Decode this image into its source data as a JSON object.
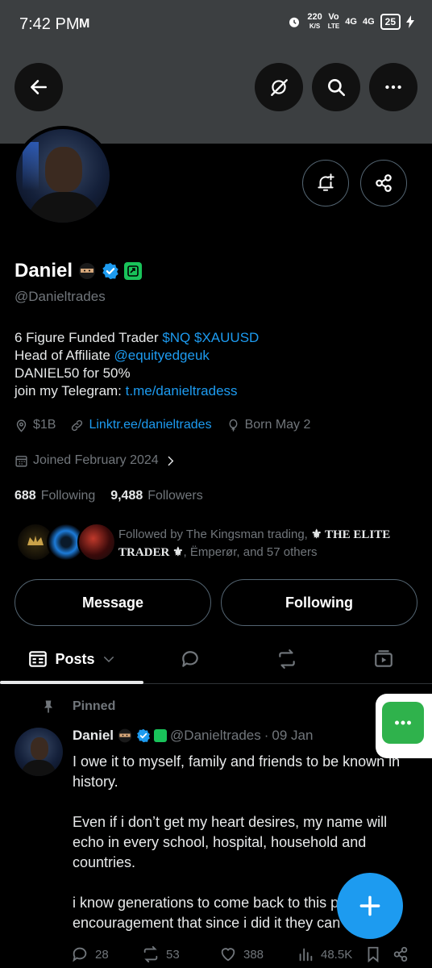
{
  "status_bar": {
    "time": "7:42 PM",
    "mail_glyph": "M",
    "net_speed_value": "220",
    "net_speed_unit": "K/S",
    "volte_top": "Vo",
    "volte_bottom": "LTE",
    "sig1_label": "4G",
    "sig2_label": "4G",
    "battery": "25"
  },
  "profile": {
    "name": "Daniel",
    "handle": "@Danieltrades",
    "bio": {
      "line1_text": "6 Figure Funded Trader ",
      "line1_link": "$NQ $XAUUSD",
      "line2_text": "Head of Affiliate ",
      "line2_link": "@equityedgeuk",
      "line3_text": "DANIEL50 for 50%",
      "line4_text": "join my Telegram: ",
      "line4_link": "t.me/danieltradess"
    },
    "location": "$1B",
    "website": "Linktr.ee/danieltrades",
    "birthday": "Born May 2",
    "joined": "Joined February 2024",
    "following_count": "688",
    "following_label": "Following",
    "followers_count": "9,488",
    "followers_label": "Followers",
    "followed_by_prefix": "Followed by The Kingsman trading, ",
    "followed_by_elite": "⚜ THE ELITE TRADER ⚜",
    "followed_by_suffix": ", Ëmperør, and 57 others"
  },
  "actions": {
    "message_label": "Message",
    "following_label": "Following"
  },
  "tabs": {
    "posts_label": "Posts"
  },
  "post": {
    "pinned_label": "Pinned",
    "author": "Daniel",
    "handle": "@Danieltrades",
    "separator": "·",
    "date": "09 Jan",
    "paragraph1": "I owe it to myself, family and friends to be known in history.",
    "paragraph2": "Even if i don’t get my heart desires, my name will echo in every school, hospital, household and countries.",
    "paragraph3": "i know generations to come back to this post as an encouragement that since i did it they can too",
    "replies": "28",
    "reposts": "53",
    "likes": "388",
    "views": "48.5K"
  },
  "colors": {
    "accent": "#1d9bf0",
    "muted": "#71767b",
    "verified": "#1d9bf0",
    "affiliate_badge": "#19c35a",
    "header_bg": "#3c3f41"
  },
  "icons": {
    "back": "arrow-left-icon",
    "grok": "grok-icon",
    "search": "search-icon",
    "more": "more-horizontal-icon",
    "notify": "bell-plus-icon",
    "share": "share-icon"
  }
}
